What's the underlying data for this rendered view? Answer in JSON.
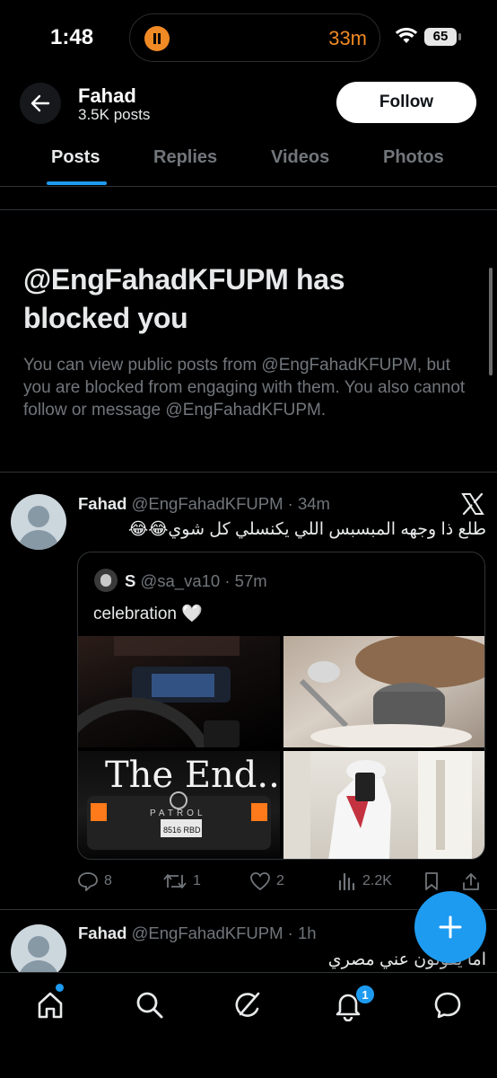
{
  "status_bar": {
    "time": "1:48",
    "activity_timer": "33m",
    "battery": "65"
  },
  "header": {
    "name": "Fahad",
    "post_count": "3.5K posts",
    "follow_label": "Follow"
  },
  "tabs": [
    {
      "label": "Posts",
      "active": true
    },
    {
      "label": "Replies",
      "active": false
    },
    {
      "label": "Videos",
      "active": false
    },
    {
      "label": "Photos",
      "active": false
    }
  ],
  "blocked_notice": {
    "title": "@EngFahadKFUPM has blocked you",
    "description": "You can view public posts from @EngFahadKFUPM, but you are blocked from engaging with them. You also cannot follow or message @EngFahadKFUPM."
  },
  "tweets": [
    {
      "name": "Fahad",
      "meta": "@EngFahadKFUPM · 34m",
      "text": "طلع ذا وجهه المبسبس اللي يكنسلي كل شوي😂😂",
      "quote": {
        "name": "S",
        "meta": "@sa_va10 · 57m",
        "text": "celebration",
        "emoji": "🤍",
        "image_captions": [
          "The End..",
          "PATROL",
          "8516 RBD"
        ]
      },
      "actions": {
        "replies": "8",
        "reposts": "1",
        "likes": "2",
        "views": "2.2K"
      }
    },
    {
      "name": "Fahad",
      "meta": "@EngFahadKFUPM · 1h",
      "text": "اما يقولون عني مصري"
    }
  ],
  "bottom_nav": {
    "notifications_badge": "1"
  },
  "colors": {
    "accent": "#1d9bf0",
    "background": "#000000",
    "text_primary": "#e7e9ea",
    "text_secondary": "#71767b",
    "border": "#2f3336",
    "activity": "#f08a24"
  }
}
